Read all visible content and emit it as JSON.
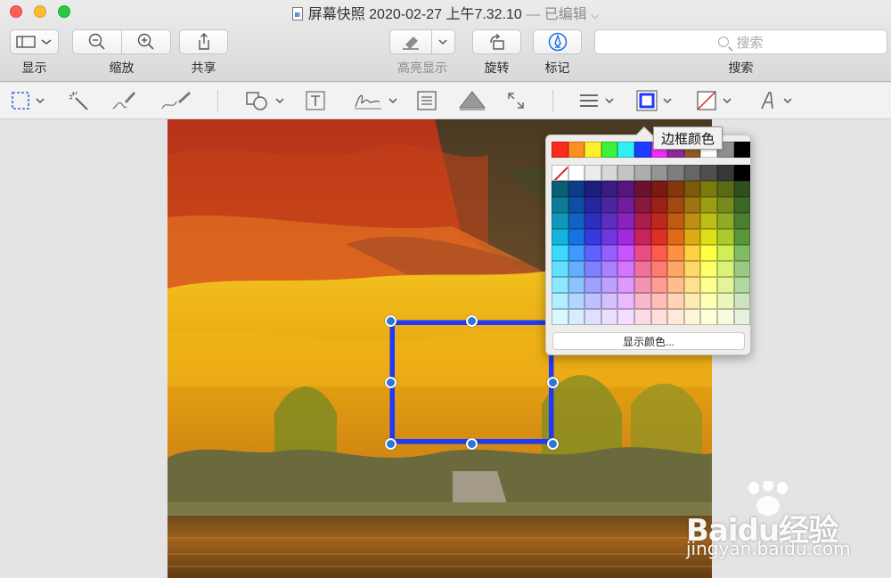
{
  "window": {
    "title": "屏幕快照 2020-02-27 上午7.32.10",
    "edited_suffix": "— 已编辑",
    "chevron": "⌵"
  },
  "toolbar": {
    "view_label": "显示",
    "zoom_label": "缩放",
    "share_label": "共享",
    "highlight_label": "高亮显示",
    "rotate_label": "旋转",
    "markup_label": "标记",
    "search_label": "搜索",
    "search_placeholder": "搜索"
  },
  "popover": {
    "tooltip": "边框颜色",
    "show_colors_button": "显示颜色...",
    "top_row": [
      "#fc2a1f",
      "#fd8f22",
      "#fdf02b",
      "#3df23c",
      "#2ff0f3",
      "#1b3dff",
      "#f22bf8",
      "#8a2a9b",
      "#8b5a26",
      "#ffffff",
      "#8f8f8f",
      "#000000"
    ],
    "grays": [
      "none",
      "#ffffff",
      "#ececec",
      "#d8d8d8",
      "#c4c4c4",
      "#adadad",
      "#959595",
      "#7e7e7e",
      "#666666",
      "#4f4f4f",
      "#373737",
      "#000000"
    ],
    "hue_columns": [
      "#0a5f75",
      "#0b3d86",
      "#1c1e7d",
      "#3a1d83",
      "#56167a",
      "#6a1230",
      "#7b1a12",
      "#82380c",
      "#7d5a0b",
      "#7b7c0e",
      "#5a6b17",
      "#2f4f1e"
    ]
  },
  "selection_color": "#1d39ff",
  "watermark": {
    "brand": "Baidu经验",
    "url": "jingyan.baidu.com"
  }
}
